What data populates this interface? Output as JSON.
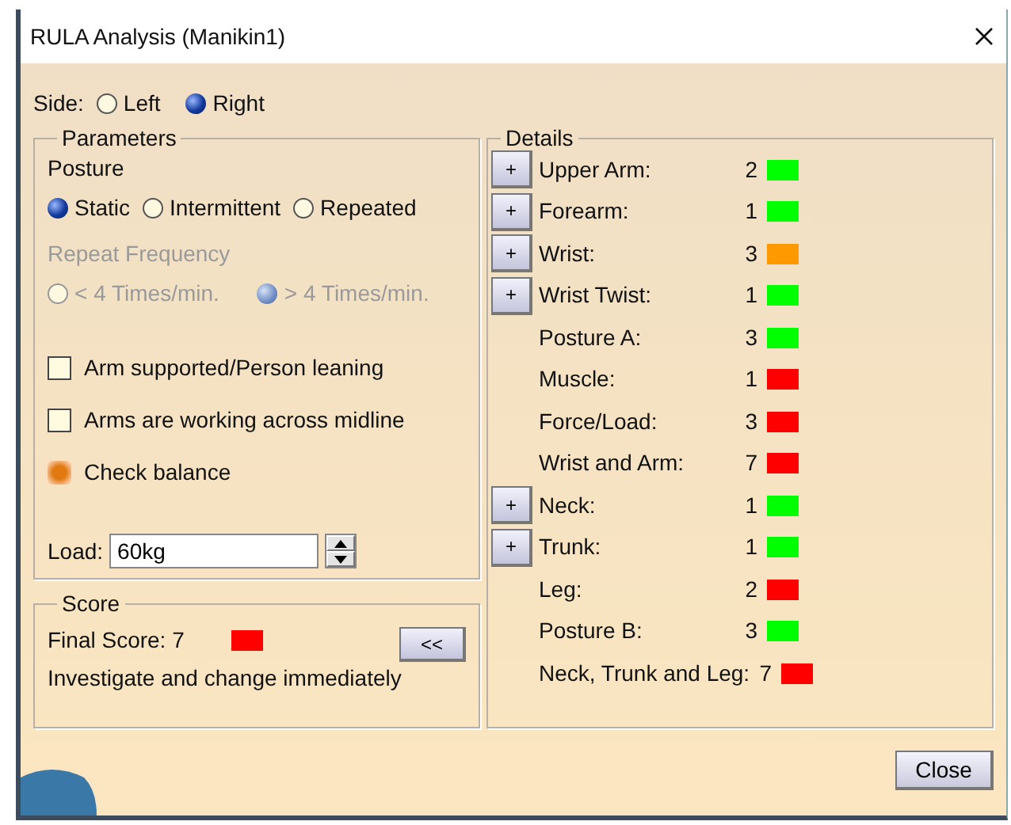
{
  "window": {
    "title": "RULA Analysis (Manikin1)"
  },
  "side": {
    "label": "Side:",
    "options": [
      {
        "label": "Left",
        "selected": false
      },
      {
        "label": "Right",
        "selected": true
      }
    ]
  },
  "parameters": {
    "title": "Parameters",
    "posture_label": "Posture",
    "posture_options": [
      {
        "label": "Static",
        "selected": true
      },
      {
        "label": "Intermittent",
        "selected": false
      },
      {
        "label": "Repeated",
        "selected": false
      }
    ],
    "repeat_frequency": {
      "label": "Repeat Frequency",
      "disabled": true,
      "options": [
        {
          "label": "< 4 Times/min.",
          "selected": false
        },
        {
          "label": "> 4 Times/min.",
          "selected": true
        }
      ]
    },
    "checkboxes": [
      {
        "label": "Arm supported/Person leaning",
        "checked": false
      },
      {
        "label": "Arms are working across midline",
        "checked": false
      },
      {
        "label": "Check balance",
        "checked": true
      }
    ],
    "load": {
      "label": "Load:",
      "value": "60kg"
    }
  },
  "score": {
    "title": "Score",
    "final_score": "Final Score: 7",
    "color": "#ff0000",
    "message": "Investigate and change immediately",
    "collapse_button": "<<"
  },
  "details": {
    "title": "Details",
    "items": [
      {
        "label": "Upper Arm:",
        "value": "2",
        "color": "#00ff00",
        "button": "+"
      },
      {
        "label": "Forearm:",
        "value": "1",
        "color": "#00ff00",
        "button": "+"
      },
      {
        "label": "Wrist:",
        "value": "3",
        "color": "#ff9900",
        "button": "+"
      },
      {
        "label": "Wrist Twist:",
        "value": "1",
        "color": "#00ff00",
        "button": "+"
      },
      {
        "label": "Posture A:",
        "value": "3",
        "color": "#00ff00"
      },
      {
        "label": "Muscle:",
        "value": "1",
        "color": "#ff0000"
      },
      {
        "label": "Force/Load:",
        "value": "3",
        "color": "#ff0000"
      },
      {
        "label": "Wrist and Arm:",
        "value": "7",
        "color": "#ff0000"
      },
      {
        "label": "Neck:",
        "value": "1",
        "color": "#00ff00",
        "button": "+"
      },
      {
        "label": "Trunk:",
        "value": "1",
        "color": "#00ff00",
        "button": "+"
      },
      {
        "label": "Leg:",
        "value": "2",
        "color": "#ff0000"
      },
      {
        "label": "Posture B:",
        "value": "3",
        "color": "#00ff00"
      },
      {
        "label": "Neck, Trunk and Leg:",
        "value": "7",
        "color": "#ff0000"
      }
    ]
  },
  "close_button": "Close"
}
